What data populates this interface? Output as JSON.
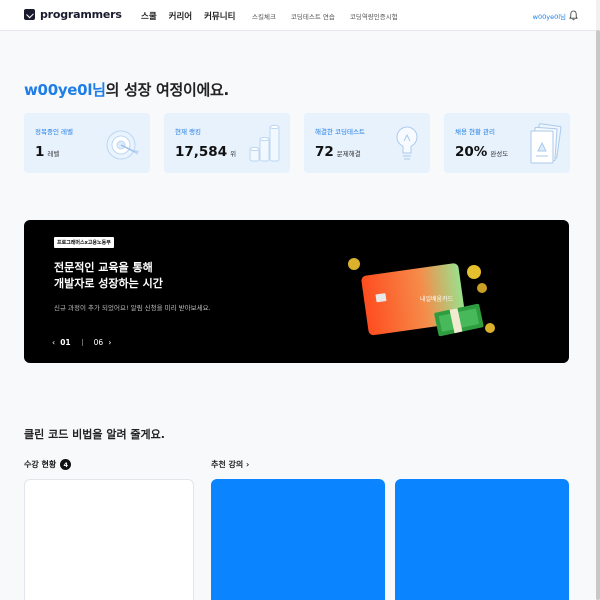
{
  "header": {
    "logo_text": "programmers",
    "nav_main": [
      "스쿨",
      "커리어",
      "커뮤니티"
    ],
    "nav_sub": [
      "스킬체크",
      "코딩테스트 연습",
      "코딩역량인증시험"
    ],
    "user": "w00ye0l님",
    "bell_icon": "bell-icon"
  },
  "greeting": {
    "username": "w00ye0l님",
    "rest": "의 성장 여정이에요."
  },
  "cards": [
    {
      "label": "정복중인 레벨",
      "value": "1",
      "unit": "레벨",
      "icon": "target-icon"
    },
    {
      "label": "현재 랭킹",
      "value": "17,584",
      "unit": "위",
      "icon": "coin-stack-icon"
    },
    {
      "label": "해결한 코딩테스트",
      "value": "72",
      "unit": "문제해결",
      "icon": "lightbulb-icon"
    },
    {
      "label": "채용 현황 관리",
      "value": "20%",
      "unit": "완성도",
      "icon": "document-stack-icon"
    }
  ],
  "banner": {
    "tag": "프로그래머스x고용노동부",
    "title_line1": "전문적인 교육을 통해",
    "title_line2": "개발자로 성장하는 시간",
    "subtitle": "신규 과정이 추가 되었어요! 알림 신청을 미리 받아보세요.",
    "current": "01",
    "total": "06",
    "card_text": "내일배움카드",
    "prev_icon": "chevron-left-icon",
    "next_icon": "chevron-right-icon"
  },
  "section": {
    "title": "클린 코드 비법을 알려 줄게요.",
    "left_label": "수강 현황",
    "left_count": "4",
    "right_label": "추천 강의",
    "right_icon": "chevron-right-icon"
  },
  "colors": {
    "accent": "#1e7de6",
    "card_bg": "#e8f2fd",
    "banner_bg": "#000000",
    "course_blue": "#0b84ff"
  }
}
